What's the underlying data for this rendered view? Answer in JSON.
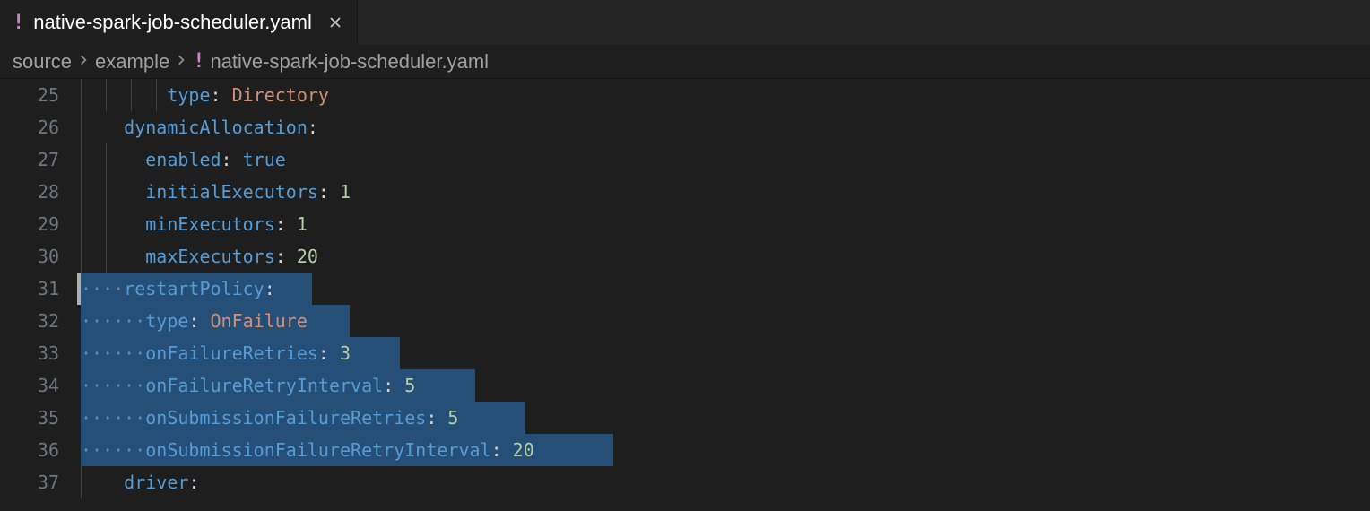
{
  "tab": {
    "filename": "native-spark-job-scheduler.yaml",
    "icon_glyph": "!"
  },
  "breadcrumbs": {
    "segments": [
      "source",
      "example"
    ],
    "file_icon": "!",
    "file": "native-spark-job-scheduler.yaml"
  },
  "editor": {
    "line_numbers": [
      "25",
      "26",
      "27",
      "28",
      "29",
      "30",
      "31",
      "32",
      "33",
      "34",
      "35",
      "36",
      "37"
    ],
    "active_line": "31",
    "lines": [
      {
        "indent": 8,
        "key": "type",
        "value": "Directory",
        "vclass": "val-str",
        "selected": false,
        "guides": [
          0,
          28,
          56,
          84
        ]
      },
      {
        "indent": 4,
        "key": "dynamicAllocation",
        "value": "",
        "vclass": "",
        "selected": false,
        "guides": [
          0
        ]
      },
      {
        "indent": 6,
        "key": "enabled",
        "value": "true",
        "vclass": "val-bool",
        "selected": false,
        "guides": [
          0,
          28
        ]
      },
      {
        "indent": 6,
        "key": "initialExecutors",
        "value": "1",
        "vclass": "val-num",
        "selected": false,
        "guides": [
          0,
          28
        ]
      },
      {
        "indent": 6,
        "key": "minExecutors",
        "value": "1",
        "vclass": "val-num",
        "selected": false,
        "guides": [
          0,
          28
        ]
      },
      {
        "indent": 6,
        "key": "maxExecutors",
        "value": "20",
        "vclass": "val-num",
        "selected": false,
        "guides": [
          0,
          28
        ]
      },
      {
        "indent": 4,
        "key": "restartPolicy",
        "value": "",
        "vclass": "",
        "selected": true,
        "cursor": true,
        "guides": []
      },
      {
        "indent": 6,
        "key": "type",
        "value": "OnFailure",
        "vclass": "val-str",
        "selected": true,
        "guides": []
      },
      {
        "indent": 6,
        "key": "onFailureRetries",
        "value": "3",
        "vclass": "val-num",
        "selected": true,
        "guides": []
      },
      {
        "indent": 6,
        "key": "onFailureRetryInterval",
        "value": "5",
        "vclass": "val-num",
        "selected": true,
        "guides": []
      },
      {
        "indent": 6,
        "key": "onSubmissionFailureRetries",
        "value": "5",
        "vclass": "val-num",
        "selected": true,
        "guides": []
      },
      {
        "indent": 6,
        "key": "onSubmissionFailureRetryInterval",
        "value": "20",
        "vclass": "val-num",
        "selected": true,
        "guides": []
      },
      {
        "indent": 4,
        "key": "driver",
        "value": "",
        "vclass": "",
        "selected": false,
        "guides": [
          0
        ]
      }
    ]
  }
}
